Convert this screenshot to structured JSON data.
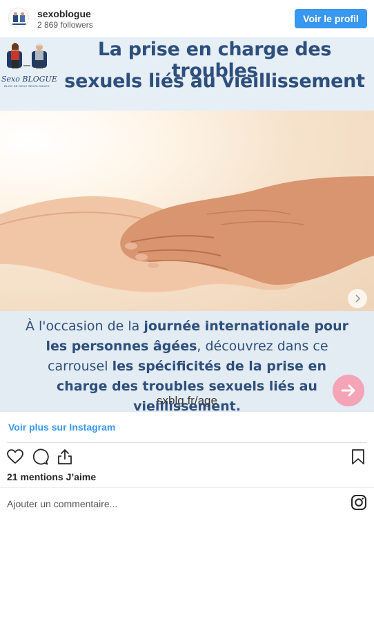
{
  "header": {
    "username": "sexoblogue",
    "followers": "2 869 followers",
    "profile_button": "Voir le profil"
  },
  "post": {
    "title_line1": "La prise en charge des troubles",
    "title_line2": "sexuels liés au vieillissement",
    "logo_text": "Sexo BLOGUE",
    "logo_subtext": "BLOG DE DEUX SEXOLOGUES",
    "caption_part1": "À l'occasion de la ",
    "caption_bold1": "journée internationale pour les personnes âgées",
    "caption_part2": ", découvrez dans ce carrousel ",
    "caption_bold2": "les spécificités de la prise en charge des troubles sexuels liés au vieillissement.",
    "url": "sxblg.fr/age"
  },
  "actions": {
    "see_more": "Voir plus sur Instagram",
    "likes": "21 mentions J’aime"
  },
  "comment": {
    "placeholder": "Ajouter un commentaire..."
  },
  "colors": {
    "accent": "#3897f0",
    "title": "#2d4f7c",
    "arrow": "#f4a4b6"
  },
  "icons": [
    "heart-icon",
    "comment-icon",
    "share-icon",
    "bookmark-icon",
    "instagram-icon",
    "chevron-right-icon",
    "arrow-right-icon"
  ]
}
